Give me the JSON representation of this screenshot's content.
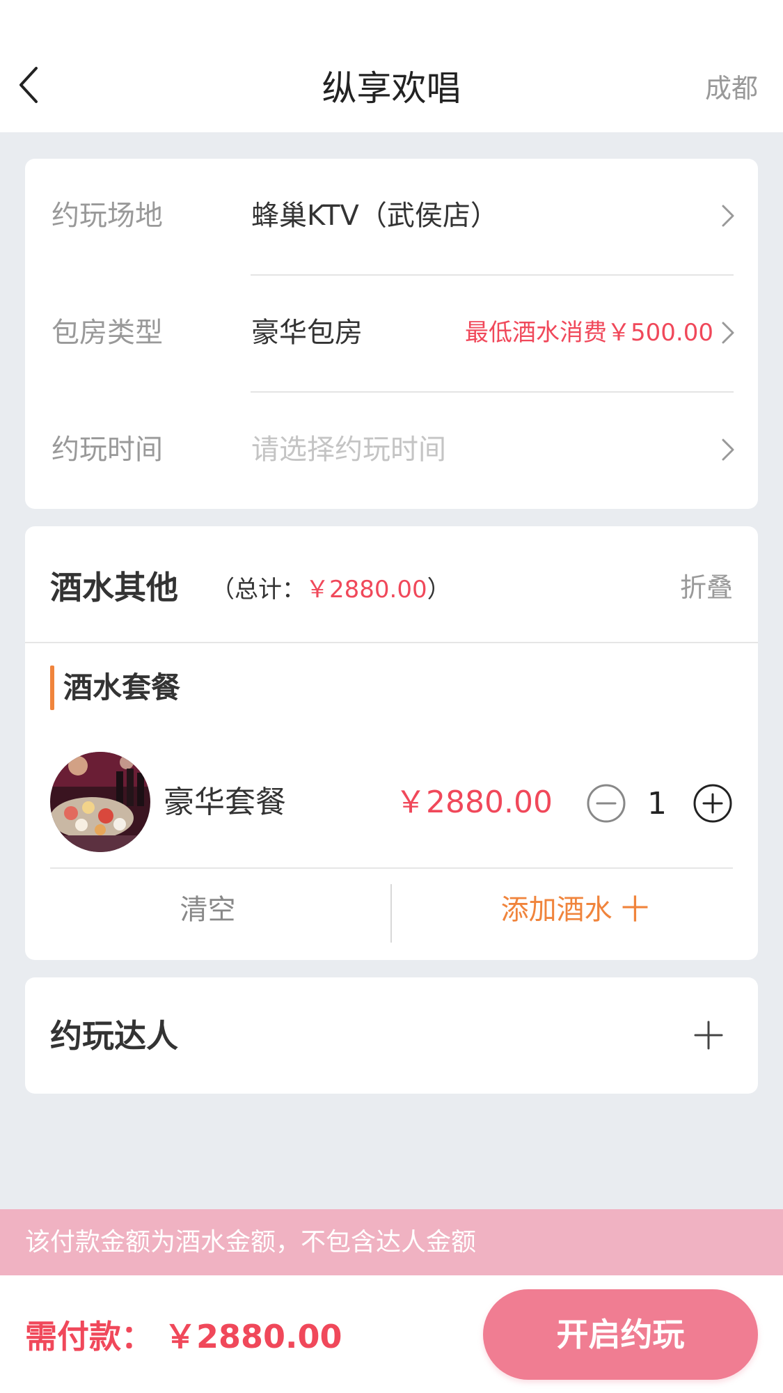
{
  "nav": {
    "title": "纵享欢唱",
    "city": "成都",
    "back_icon": "chevron-left-icon"
  },
  "venue": {
    "label": "约玩场地",
    "value": "蜂巢KTV（武侯店）"
  },
  "room": {
    "label": "包房类型",
    "value": "豪华包房",
    "note": "最低酒水消费￥500.00"
  },
  "time": {
    "label": "约玩时间",
    "placeholder": "请选择约玩时间"
  },
  "drinks": {
    "title": "酒水其他",
    "total_open": "（总计：",
    "total_amount": "￥2880.00",
    "total_close": "）",
    "fold_label": "折叠",
    "package_title": "酒水套餐",
    "item": {
      "name": "豪华套餐",
      "price": "￥2880.00",
      "quantity": "1"
    },
    "clear_label": "清空",
    "add_label": "添加酒水 十"
  },
  "expert": {
    "title": "约玩达人"
  },
  "notice": "该付款金额为酒水金额，不包含达人金额",
  "footer": {
    "pay_label": "需付款：",
    "pay_amount": "￥2880.00",
    "start_label": "开启约玩"
  },
  "colors": {
    "accent_red": "#f0485a",
    "accent_orange": "#f0843c",
    "button_pink": "#f07d92",
    "notice_pink": "#f0b2c2",
    "background": "#e9ecf0"
  }
}
